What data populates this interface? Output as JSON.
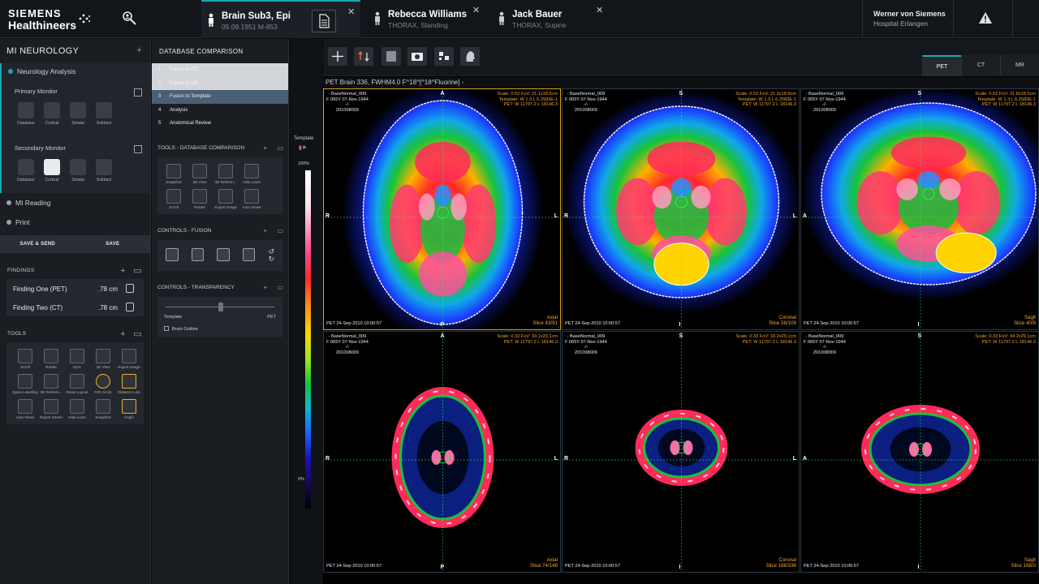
{
  "brand": {
    "line1": "SIEMENS",
    "line2": "Healthineers"
  },
  "tabs": [
    {
      "name": "Brain Sub3, Epi",
      "sub": "05.09.1951   M-853",
      "active": true
    },
    {
      "name": "Rebecca Williams",
      "sub": "THORAX, Standing",
      "active": false
    },
    {
      "name": "Jack Bauer",
      "sub": "THORAX, Supine",
      "active": false
    }
  ],
  "user": {
    "name": "Werner von Siemens",
    "site": "Hospital Erlangen"
  },
  "left": {
    "title": "MI NEUROLOGY",
    "neuro": "Neurology Analysis",
    "primary": "Primary Monitor",
    "secondary": "Secondary Monitor",
    "monitor_icons": [
      "Database",
      "Cortical",
      "Striatal",
      "Subtract"
    ],
    "mi_reading": "MI Reading",
    "print": "Print",
    "save_send": "SAVE & SEND",
    "save": "SAVE",
    "findings_title": "FINDINGS",
    "findings": [
      {
        "name": "Finding One (PET)",
        "value": ".78 cm"
      },
      {
        "name": "Finding Two (CT)",
        "value": ".78 cm"
      }
    ],
    "tools_title": "TOOLS",
    "tools": [
      "Scroll",
      "Rotate",
      "Sync",
      "2D View",
      "Export Image",
      "Spine Labelling",
      "3D Referen...",
      "Reset Layout",
      "ROI Circle",
      "Distance Line",
      "Auto Views",
      "Export Series",
      "Hide Lines",
      "Snapshot",
      "Angle"
    ]
  },
  "mid": {
    "title": "DATABASE COMPARISON",
    "workflow": [
      {
        "num": "1",
        "label": "Fusion to CT",
        "state": "done"
      },
      {
        "num": "2",
        "label": "Fusion to MR",
        "state": "done"
      },
      {
        "num": "3",
        "label": "Fusion to Template",
        "state": "current"
      },
      {
        "num": "4",
        "label": "Analysis",
        "state": "todo"
      },
      {
        "num": "5",
        "label": "Anatomical Review",
        "state": "todo"
      }
    ],
    "tools_title": "TOOLS - DATABASE COMPARISON",
    "db_tools": [
      "Snapshot",
      "2D View",
      "3D Referen...",
      "Hide Lines",
      "Scroll",
      "Rotate",
      "Export Image",
      "Auto Views"
    ],
    "fusion_title": "CONTROLS - FUSION",
    "transparency_title": "CONTROLS - TRANSPARENCY",
    "slider_left": "Template",
    "slider_right": "PET",
    "slider_value": 0.5,
    "brain_outline": "Brain Outline"
  },
  "colorbar": {
    "label": "Template",
    "top": "100%",
    "bottom": "0%"
  },
  "viewer": {
    "title": "PET Brain 336, FWHM4.0     F^18^[^18^Fluorine]   -",
    "modality_tabs": [
      "PET",
      "CT",
      "MR"
    ],
    "active_modality": "PET",
    "cells": [
      {
        "tl": "- BaseNormal_009\nF 065Y 07-Nov-1944\n-/-\n201008009",
        "tr": "Scale: 0.52 FoV: 21.1x18.5cm\nTemplate: W 1.3 L 6.2583E-1\nPET: W 11797.2 L 18146.3",
        "br1": "Axial",
        "br2": "Slice 43/91",
        "bl": "PET 24-Sep-2010 10:00:57",
        "top": "A",
        "bottom": "P",
        "left": "R",
        "right": "L"
      },
      {
        "tl": "- BaseNormal_009\nF 065Y 07-Nov-1944\n-/-\n201008009",
        "tr": "Scale: 0.52 FoV: 21.2x18.6cm\nTemplate: W 1.3 L 6.2583E-1\nPET: W 11797.2 L 18146.3",
        "br1": "Coronal",
        "br2": "Slice 58/109",
        "bl": "PET 24-Sep-2010 10:00:57",
        "top": "S",
        "bottom": "I",
        "left": "R",
        "right": "L"
      },
      {
        "tl": "- BaseNormal_009\nF 065Y 07-Nov-1944\n-/-\n201008009",
        "tr": "Scale: 0.52 FoV: 21.8x18.5cm\nTemplate: W 1.3 L 6.2583E-1\nPET: W 11797.2 L 18146.3",
        "br1": "Sagit",
        "br2": "Slice 40/9",
        "bl": "PET 24-Sep-2010 10:00:57",
        "top": "S",
        "bottom": "I",
        "left": "A",
        "right": ""
      },
      {
        "tl": "- BaseNormal_009\nF 065Y 07-Nov-1944\n-/-\n201008009",
        "tr": "Scale: 0.33 FoV: 33.1x29.1cm\nPET: W 11797.2 L 18146.3",
        "br1": "Axial",
        "br2": "Slice 74/148",
        "bl": "PET 24-Sep-2010 10:00:57",
        "top": "A",
        "bottom": "P",
        "left": "R",
        "right": "L"
      },
      {
        "tl": "- BaseNormal_009\nF 065Y 07-Nov-1944\n-/-\n201008009",
        "tr": "Scale: 0.33 FoV: 33.2x29.1cm\nPET: W 11797.2 L 18146.3",
        "br1": "Coronal",
        "br2": "Slice 168/336",
        "bl": "PET 24-Sep-2010 10:00:57",
        "top": "S",
        "bottom": "I",
        "left": "R",
        "right": "L"
      },
      {
        "tl": "- BaseNormal_009\nF 065Y 07-Nov-1944\n-/-\n201008009",
        "tr": "Scale: 0.33 FoV: 34.2x29.1cm\nPET: W 11797.2 L 18146.3",
        "br1": "Sagit",
        "br2": "Slice 168/3",
        "bl": "PET 24-Sep-2010 10:00:57",
        "top": "S",
        "bottom": "I",
        "left": "A",
        "right": ""
      }
    ]
  },
  "colors": {
    "accent": "#1ea7b0",
    "selected_border": "#d9a21a",
    "overlay_orange": "#f2a530"
  }
}
